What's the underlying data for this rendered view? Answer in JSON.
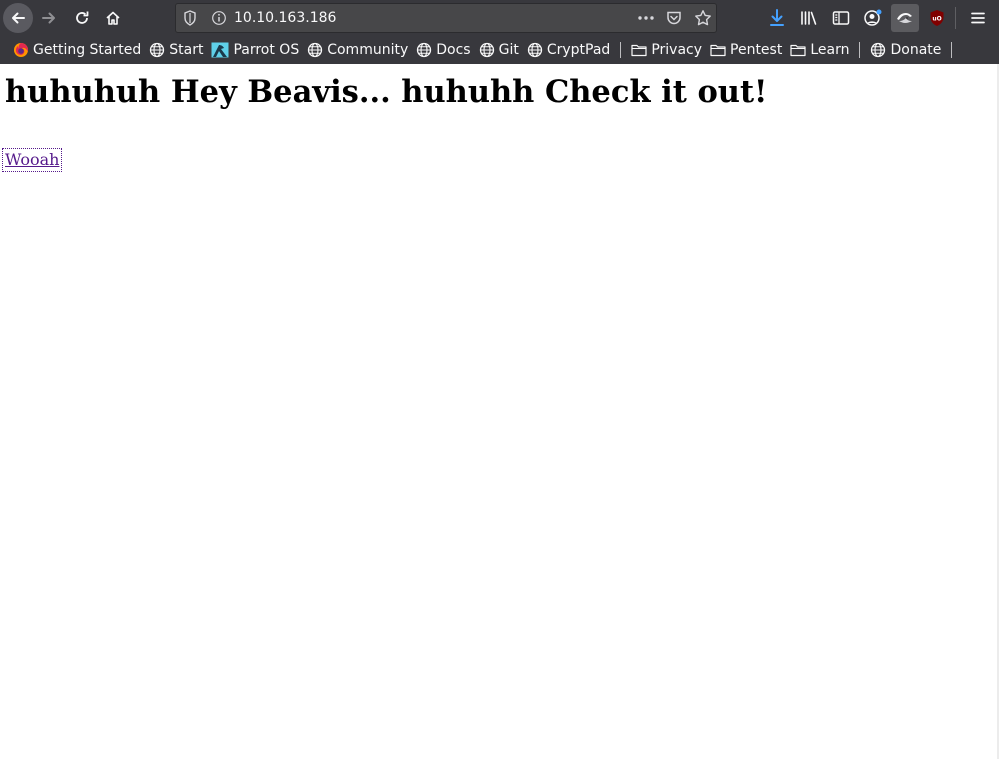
{
  "browser": {
    "url": "10.10.163.186",
    "toolbar_icons": [
      "back-icon",
      "forward-icon",
      "reload-icon",
      "home-icon",
      "tracking-shield-icon",
      "info-icon",
      "page-actions-icon",
      "pocket-icon",
      "bookmark-star-icon",
      "download-icon",
      "library-icon",
      "sidebar-icon",
      "account-icon",
      "extension-icon",
      "ublock-icon",
      "hamburger-menu-icon"
    ],
    "bookmarks": [
      {
        "label": "Getting Started",
        "icon": "firefox-icon"
      },
      {
        "label": "Start",
        "icon": "globe-icon"
      },
      {
        "label": "Parrot OS",
        "icon": "parrot-icon"
      },
      {
        "label": "Community",
        "icon": "globe-icon"
      },
      {
        "label": "Docs",
        "icon": "globe-icon"
      },
      {
        "label": "Git",
        "icon": "globe-icon"
      },
      {
        "label": "CryptPad",
        "icon": "globe-icon"
      },
      {
        "label": "Privacy",
        "icon": "folder-icon"
      },
      {
        "label": "Pentest",
        "icon": "folder-icon"
      },
      {
        "label": "Learn",
        "icon": "folder-icon"
      },
      {
        "label": "Donate",
        "icon": "globe-icon"
      }
    ],
    "colors": {
      "chrome": "#38383d",
      "urlbar": "#474749",
      "download_accent": "#45a1ff",
      "link_visited": "#551a8b"
    }
  },
  "page": {
    "heading": "huhuhuh Hey Beavis... huhuhh Check it out!",
    "link_text": "Wooah"
  }
}
